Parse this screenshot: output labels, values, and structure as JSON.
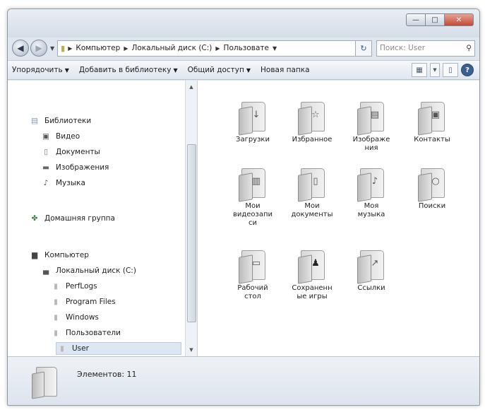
{
  "window": {
    "controls": {
      "minimize": "—",
      "maximize": "□",
      "close": "✕"
    }
  },
  "address_bar": {
    "crumbs": [
      "Компьютер",
      "Локальный диск (C:)",
      "Пользовате"
    ],
    "search_placeholder": "Поиск: User"
  },
  "toolbar": {
    "organize": "Упорядочить",
    "add_to_library": "Добавить в библиотеку",
    "share": "Общий доступ",
    "new_folder": "Новая папка"
  },
  "nav": {
    "libraries": "Библиотеки",
    "video": "Видео",
    "documents": "Документы",
    "pictures": "Изображения",
    "music": "Музыка",
    "homegroup": "Домашняя группа",
    "computer": "Компьютер",
    "local_disk": "Локальный диск (C:)",
    "perflogs": "PerfLogs",
    "program_files": "Program Files",
    "windows": "Windows",
    "users": "Пользователи",
    "user": "User"
  },
  "items": [
    {
      "line1": "Загрузки",
      "line2": "",
      "line3": "",
      "icon": "download-arrow-icon"
    },
    {
      "line1": "Избранное",
      "line2": "",
      "line3": "",
      "icon": "star-icon"
    },
    {
      "line1": "Изображе",
      "line2": "ния",
      "line3": "",
      "icon": "picture-icon"
    },
    {
      "line1": "Контакты",
      "line2": "",
      "line3": "",
      "icon": "contact-card-icon"
    },
    {
      "line1": "Мои",
      "line2": "видеозапи",
      "line3": "си",
      "icon": "film-icon"
    },
    {
      "line1": "Мои",
      "line2": "документы",
      "line3": "",
      "icon": "document-icon"
    },
    {
      "line1": "Моя",
      "line2": "музыка",
      "line3": "",
      "icon": "music-note-icon"
    },
    {
      "line1": "Поиски",
      "line2": "",
      "line3": "",
      "icon": "magnifier-icon"
    },
    {
      "line1": "Рабочий",
      "line2": "стол",
      "line3": "",
      "icon": "desktop-icon"
    },
    {
      "line1": "Сохраненн",
      "line2": "ые игры",
      "line3": "",
      "icon": "chess-piece-icon"
    },
    {
      "line1": "Ссылки",
      "line2": "",
      "line3": "",
      "icon": "link-arrow-icon"
    }
  ],
  "details": {
    "count_text": "Элементов: 11"
  }
}
